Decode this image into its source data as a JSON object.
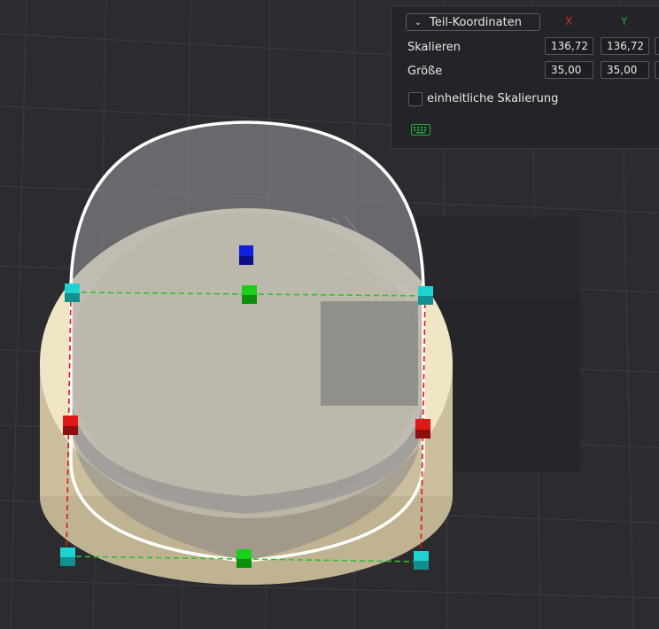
{
  "panel": {
    "coordinate_system": "Teil-Koordinaten",
    "axes": {
      "x_label": "X",
      "y_label": "Y",
      "x_color": "#d42c2c",
      "y_color": "#1faa3a"
    },
    "rows": [
      {
        "label": "Skalieren",
        "x_value": "136,72",
        "y_value": "136,72"
      },
      {
        "label": "Größe",
        "x_value": "35,00",
        "y_value": "35,00"
      }
    ],
    "uniform_scaling_label": "einheitliche Skalierung",
    "uniform_scaling_checked": false,
    "keyboard_icon": "keyboard-icon",
    "accent_color": "#1faa3a"
  },
  "viewport": {
    "background_color": "#2b2b30",
    "object_color": "#e8dcb8",
    "handle_colors": {
      "corner": "#1fd3d3",
      "side_x": "#e01818",
      "side_y": "#18d018",
      "z": "#1020e0"
    },
    "bounding_box_colors": {
      "x_edges": "#e01818",
      "y_edges": "#30c030",
      "outline": "#ffffff"
    }
  }
}
